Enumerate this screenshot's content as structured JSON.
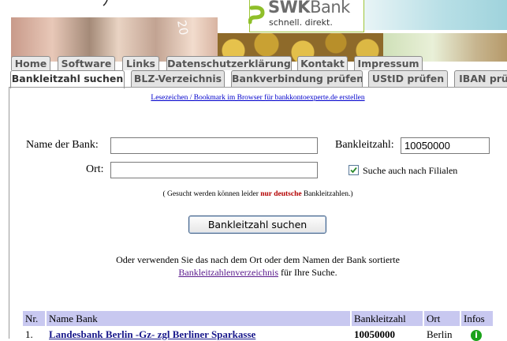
{
  "logo": {
    "name_bold": "SWK",
    "name_rest": "Bank",
    "slogan": "schnell. direkt."
  },
  "banner": {
    "note_number": "20"
  },
  "tabs_row1": [
    "Home",
    "Software",
    "Links",
    "Datenschutzerklärung",
    "Kontakt",
    "Impressum"
  ],
  "tabs_row2": [
    "Bankleitzahl suchen",
    "BLZ-Verzeichnis",
    "Bankverbindung prüfen",
    "UStID prüfen",
    "IBAN prü"
  ],
  "active_tab": "Bankleitzahl suchen",
  "bookmark_link": "Lesezeichen / Bookmark im Browser für bankkontoexperte.de erstellen",
  "form": {
    "bank_name_label": "Name der Bank:",
    "bank_name_value": "",
    "blz_label": "Bankleitzahl:",
    "blz_value": "10050000",
    "ort_label": "Ort:",
    "ort_value": "",
    "branches_label": "Suche auch nach Filialen",
    "branches_checked": true,
    "note_before": "( Gesucht werden können leider ",
    "note_highlight": "nur deutsche",
    "note_after": " Bankleitzahlen.)",
    "submit_label": "Bankleitzahl suchen"
  },
  "alt_text": {
    "line1": "Oder verwenden Sie das nach dem Ort oder dem Namen der Bank sortierte",
    "link": "Bankleitzahlenverzeichnis",
    "line2_rest": " für Ihre Suche."
  },
  "table": {
    "headers": [
      "Nr.",
      "Name Bank",
      "Bankleitzahl",
      "Ort",
      "Infos"
    ],
    "rows": [
      {
        "nr": "1.",
        "name": "Landesbank Berlin -Gz- zgl Berliner Sparkasse",
        "blz": "10050000",
        "ort": "Berlin",
        "info_icon": "info-icon"
      }
    ]
  },
  "colors": {
    "table_header_bg": "#c8c8f0",
    "link_blue": "#0000cc",
    "highlight_red": "#b40000",
    "brand_green": "#9fc63a"
  }
}
